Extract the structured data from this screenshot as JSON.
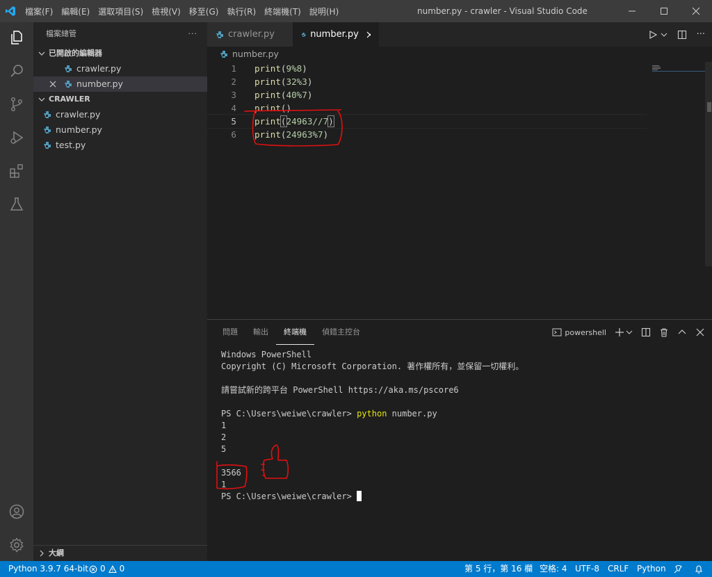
{
  "titlebar": {
    "menu": [
      "檔案(F)",
      "編輯(E)",
      "選取項目(S)",
      "檢視(V)",
      "移至(G)",
      "執行(R)",
      "終端機(T)",
      "說明(H)"
    ],
    "title": "number.py - crawler - Visual Studio Code"
  },
  "sidebar": {
    "header": "檔案總管",
    "open_editors_label": "已開啟的編輯器",
    "open_editors": [
      "crawler.py",
      "number.py"
    ],
    "folder_label": "CRAWLER",
    "files": [
      "crawler.py",
      "number.py",
      "test.py"
    ],
    "outline_label": "大綱"
  },
  "tabs": [
    {
      "label": "crawler.py"
    },
    {
      "label": "number.py"
    }
  ],
  "breadcrumb": "number.py",
  "editor": {
    "lines": [
      {
        "no": "1",
        "fn": "print",
        "arg": "9%8"
      },
      {
        "no": "2",
        "fn": "print",
        "arg": "32%3"
      },
      {
        "no": "3",
        "fn": "print",
        "arg": "40%7"
      },
      {
        "no": "4",
        "fn": "print",
        "arg": ""
      },
      {
        "no": "5",
        "fn": "print",
        "arg": "24963//7"
      },
      {
        "no": "6",
        "fn": "print",
        "arg": "24963%7"
      }
    ]
  },
  "panel": {
    "tabs": [
      "問題",
      "輸出",
      "終端機",
      "偵錯主控台"
    ],
    "shell": "powershell",
    "terminal": {
      "l1": "Windows PowerShell",
      "l2": "Copyright (C) Microsoft Corporation. 著作權所有，並保留一切權利。",
      "l3": "請嘗試新的跨平台 PowerShell https://aka.ms/pscore6",
      "prompt": "PS C:\\Users\\weiwe\\crawler> ",
      "cmd": "python",
      "cmd_arg": " number.py",
      "out1": "1",
      "out2": "2",
      "out3": "5",
      "out4": "3566",
      "out5": "1",
      "prompt2": "PS C:\\Users\\weiwe\\crawler> "
    }
  },
  "status": {
    "python": "Python 3.9.7 64-bit",
    "errors": "0",
    "warnings": "0",
    "position": "第 5 行，第 16 欄",
    "spaces": "空格: 4",
    "encoding": "UTF-8",
    "eol": "CRLF",
    "language": "Python"
  }
}
